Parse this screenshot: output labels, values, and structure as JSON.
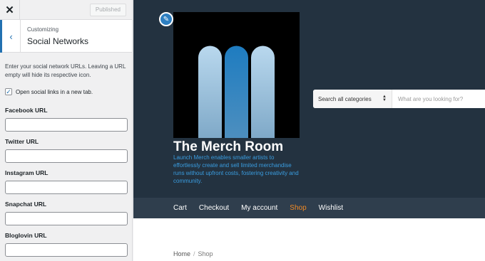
{
  "customizer": {
    "close_icon": "close-icon",
    "publish_label": "Published",
    "back_icon": "chevron-left-icon",
    "section_sub": "Customizing",
    "section_title": "Social Networks",
    "description": "Enter your social network URLs. Leaving a URL empty will hide its respective icon.",
    "checkbox_label": "Open social links in a new tab.",
    "checkbox_checked": true,
    "fields": [
      {
        "label": "Facebook URL",
        "value": ""
      },
      {
        "label": "Twitter URL",
        "value": ""
      },
      {
        "label": "Instagram URL",
        "value": ""
      },
      {
        "label": "Snapchat URL",
        "value": ""
      },
      {
        "label": "Bloglovin URL",
        "value": ""
      }
    ]
  },
  "preview": {
    "site_title": "The Merch Room",
    "tagline": "Launch Merch enables smaller artists to effortlessly create and sell limited merchandise runs without upfront costs, fostering creativity and community.",
    "search": {
      "category_label": "Search all categories",
      "placeholder": "What are you looking for?"
    },
    "nav": [
      {
        "label": "Cart",
        "active": false
      },
      {
        "label": "Checkout",
        "active": false
      },
      {
        "label": "My account",
        "active": false
      },
      {
        "label": "Shop",
        "active": true
      },
      {
        "label": "Wishlist",
        "active": false
      }
    ],
    "breadcrumb": {
      "home": "Home",
      "separator": "/",
      "current": "Shop"
    },
    "colors": {
      "hero_bg": "#233240",
      "nav_bg": "#2f3e4d",
      "accent": "#f08a24",
      "tagline": "#3a9de0",
      "admin_blue": "#2271b1"
    }
  }
}
